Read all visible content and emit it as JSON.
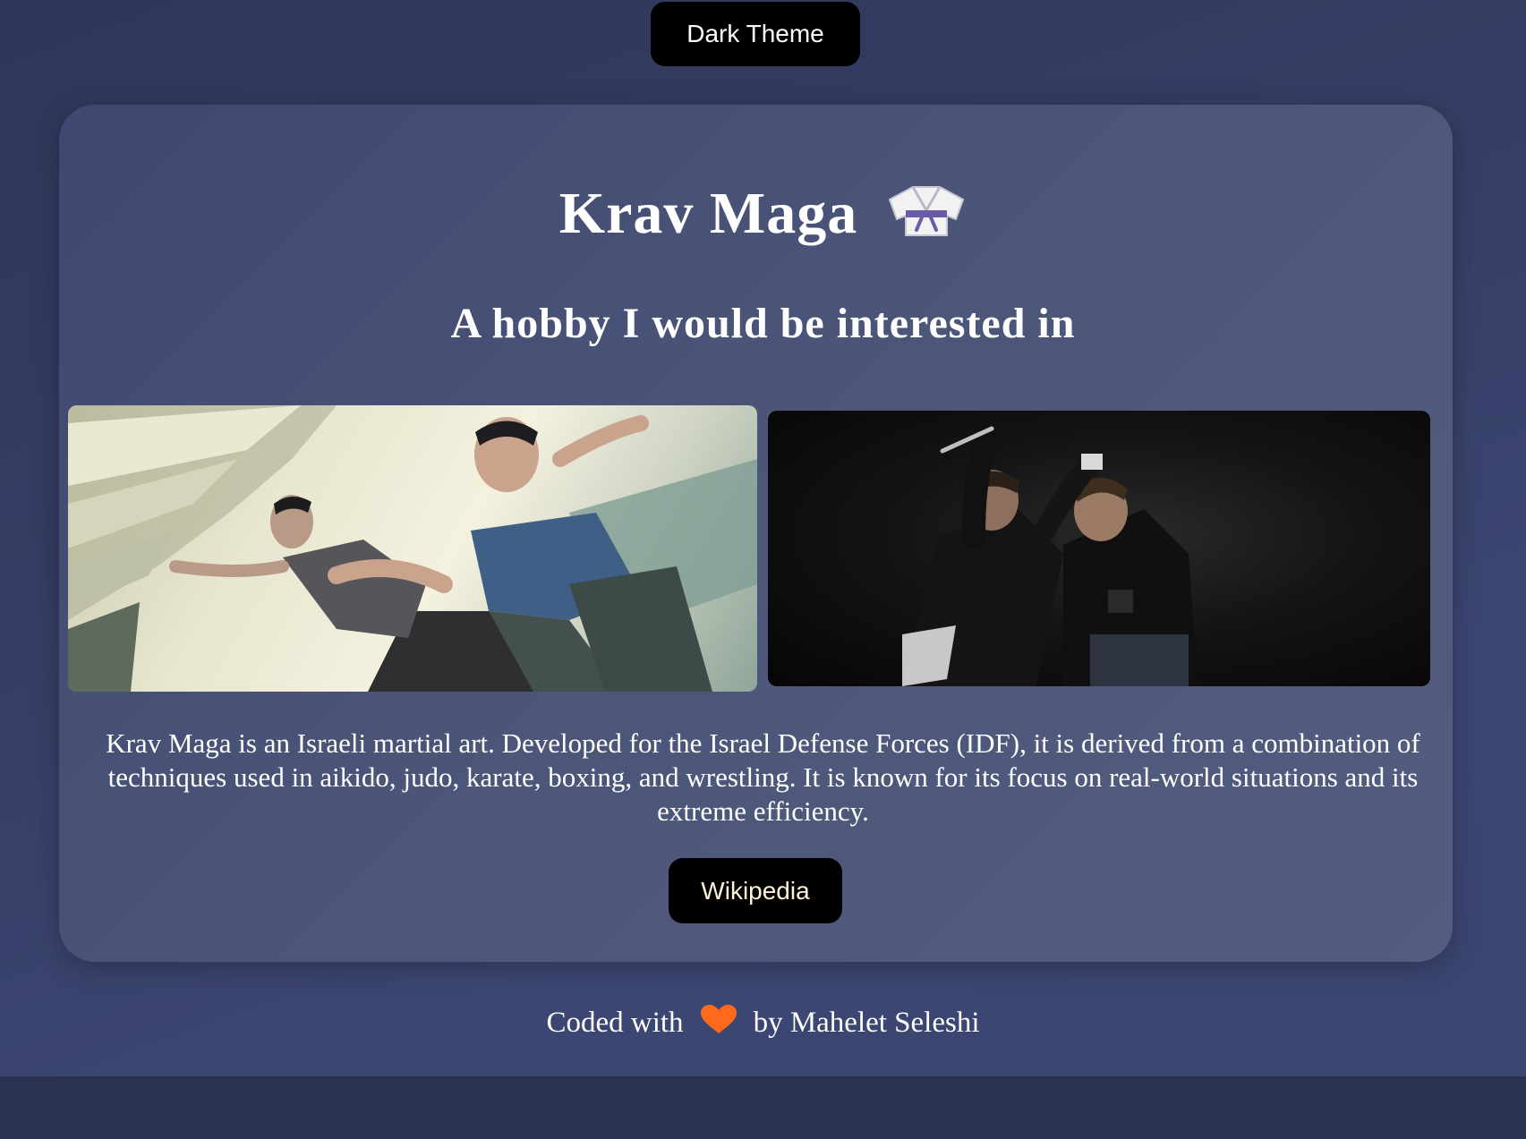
{
  "theme_toggle": {
    "label": "Dark Theme"
  },
  "card": {
    "title": "Krav Maga",
    "title_icon": "martial-arts-uniform-icon",
    "subtitle": "A hobby I would be interested in",
    "images": [
      {
        "name": "krav-maga-street-defense-photo"
      },
      {
        "name": "krav-maga-knife-defense-photo"
      }
    ],
    "description": "Krav Maga is an Israeli martial art. Developed for the Israel Defense Forces (IDF), it is derived from a combination of techniques used in aikido, judo, karate, boxing, and wrestling. It is known for its focus on real-world situations and its extreme efficiency.",
    "link_label": "Wikipedia"
  },
  "footer": {
    "prefix": "Coded with",
    "icon": "heart-icon",
    "suffix": "by Mahelet Seleshi"
  },
  "colors": {
    "background": "#343d63",
    "card": "#4b5578",
    "button": "#000000",
    "heart": "#ff6a1a"
  }
}
